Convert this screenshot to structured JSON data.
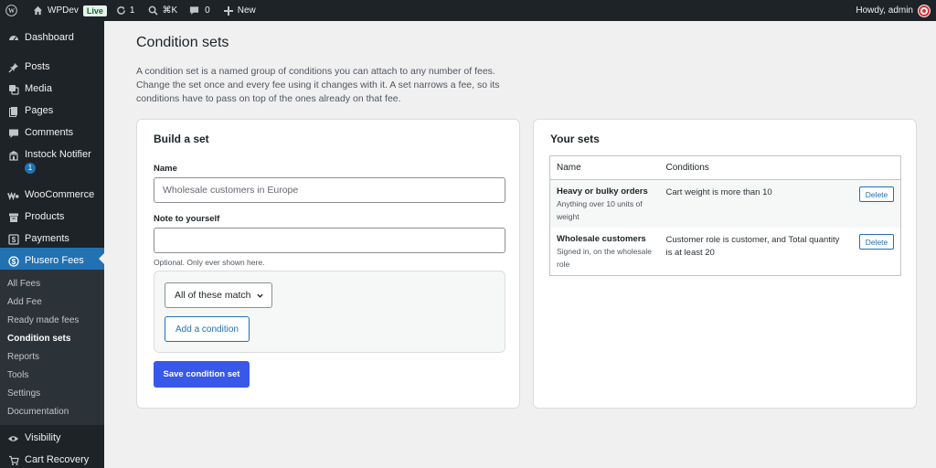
{
  "adminbar": {
    "site_name": "WPDev",
    "live_badge": "Live",
    "updates_count": "1",
    "search_shortcut": "⌘K",
    "comments_count": "0",
    "new_label": "New",
    "greeting": "Howdy, admin"
  },
  "sidebar": {
    "items": [
      {
        "label": "Dashboard",
        "icon": "dashboard-icon"
      },
      {
        "label": "Posts",
        "icon": "pin-icon"
      },
      {
        "label": "Media",
        "icon": "media-icon"
      },
      {
        "label": "Pages",
        "icon": "pages-icon"
      },
      {
        "label": "Comments",
        "icon": "comments-icon"
      },
      {
        "label": "Instock Notifier",
        "icon": "store-icon",
        "badge": "1"
      },
      {
        "label": "WooCommerce",
        "icon": "woocommerce-icon"
      },
      {
        "label": "Products",
        "icon": "archive-icon"
      },
      {
        "label": "Payments",
        "icon": "payments-icon"
      },
      {
        "label": "Plusero Fees",
        "icon": "dollar-icon"
      },
      {
        "label": "Visibility",
        "icon": "eye-icon"
      },
      {
        "label": "Cart Recovery",
        "icon": "cart-icon"
      }
    ],
    "submenu": [
      "All Fees",
      "Add Fee",
      "Ready made fees",
      "Condition sets",
      "Reports",
      "Tools",
      "Settings",
      "Documentation"
    ]
  },
  "page": {
    "title": "Condition sets",
    "intro": "A condition set is a named group of conditions you can attach to any number of fees. Change the set once and every fee using it changes with it. A set narrows a fee, so its conditions have to pass on top of the ones already on that fee."
  },
  "build": {
    "heading": "Build a set",
    "name_label": "Name",
    "name_placeholder": "Wholesale customers in Europe",
    "note_label": "Note to yourself",
    "note_value": "",
    "note_help": "Optional. Only ever shown here.",
    "match_selected": "All of these match",
    "add_condition_label": "Add a condition",
    "save_label": "Save condition set"
  },
  "sets": {
    "heading": "Your sets",
    "columns": [
      "Name",
      "Conditions"
    ],
    "rows": [
      {
        "name": "Heavy or bulky orders",
        "description": "Anything over 10 units of weight",
        "conditions": "Cart weight is more than 10",
        "action": "Delete"
      },
      {
        "name": "Wholesale customers",
        "description": "Signed in, on the wholesale role",
        "conditions": "Customer role is customer, and Total quantity is at least 20",
        "action": "Delete"
      }
    ]
  },
  "colors": {
    "admin_bar": "#1d2327",
    "accent": "#2271b1",
    "primary_button": "#3858e9",
    "live_badge_bg": "#e6f4ea"
  }
}
